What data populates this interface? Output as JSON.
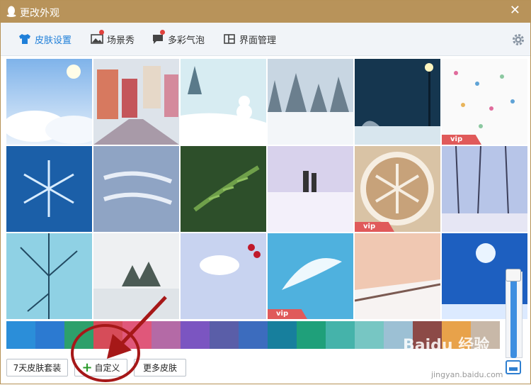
{
  "window": {
    "title": "更改外观",
    "close_label": "✕"
  },
  "tabs": [
    {
      "label": "皮肤设置",
      "icon": "tshirt-icon",
      "active": true
    },
    {
      "label": "场景秀",
      "icon": "picture-icon"
    },
    {
      "label": "多彩气泡",
      "icon": "bubble-icon"
    },
    {
      "label": "界面管理",
      "icon": "layout-icon"
    }
  ],
  "skins": [
    {
      "id": 1,
      "scene": "sky-clouds",
      "vip": false
    },
    {
      "id": 2,
      "scene": "snowy-street",
      "vip": false
    },
    {
      "id": 3,
      "scene": "snowman",
      "vip": false
    },
    {
      "id": 4,
      "scene": "snow-forest",
      "vip": false
    },
    {
      "id": 5,
      "scene": "night-lamp",
      "vip": false
    },
    {
      "id": 6,
      "scene": "snowflake-pattern",
      "vip": true
    },
    {
      "id": 7,
      "scene": "snowflake-blue",
      "vip": false
    },
    {
      "id": 8,
      "scene": "merry-christmas",
      "vip": false
    },
    {
      "id": 9,
      "scene": "pine-branch",
      "vip": false
    },
    {
      "id": 10,
      "scene": "couple-snow",
      "vip": false
    },
    {
      "id": 11,
      "scene": "latte-snowflake",
      "vip": true
    },
    {
      "id": 12,
      "scene": "winter-trees",
      "vip": false
    },
    {
      "id": 13,
      "scene": "frozen-branches",
      "vip": false
    },
    {
      "id": 14,
      "scene": "birds-lake",
      "vip": false
    },
    {
      "id": 15,
      "scene": "bird-berries",
      "vip": false
    },
    {
      "id": 16,
      "scene": "feather",
      "vip": true
    },
    {
      "id": 17,
      "scene": "snow-boardwalk",
      "vip": false
    },
    {
      "id": 18,
      "scene": "moon-reindeer",
      "vip": false
    }
  ],
  "vip_label": "vip",
  "swatches": [
    "#2b8ed9",
    "#2c7ad1",
    "#2da06b",
    "#d64c59",
    "#e0577a",
    "#b46aa6",
    "#7b55c1",
    "#5a5ea8",
    "#3c6cbe",
    "#177f9d",
    "#1fa07a",
    "#45b3aa",
    "#77c6c3",
    "#9cc0d4",
    "#8c4a47",
    "#e8a24a",
    "#c8b8a8"
  ],
  "buttons": {
    "seven_day": "7天皮肤套装",
    "custom": "自定义",
    "more": "更多皮肤"
  },
  "watermark": {
    "brand": "Baidu 经验",
    "url": "jingyan.baidu.com"
  }
}
